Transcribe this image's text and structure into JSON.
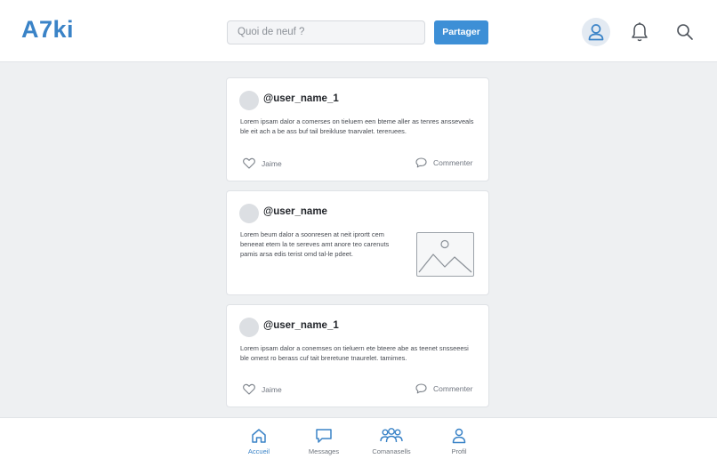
{
  "app": {
    "logo": "A7ki"
  },
  "header": {
    "composer_placeholder": "Quoi de neuf ?",
    "share_label": "Partager",
    "icons": [
      "user-icon",
      "bell-icon",
      "search-icon"
    ]
  },
  "feed": {
    "posts": [
      {
        "username": "@user_name_1",
        "body": "Lorem ipsam dalor a comerses on tieluern een bteme aller as tenres ansseveals ble eit ach a be ass buf tail breikluse tnarvalet. tereruees.",
        "like_label": "Jaime",
        "comment_label": "Commenter"
      },
      {
        "username": "@user_name",
        "body": "Lorem beum dalor a soonresen at neit iprortt cem beneeat etem la te sereves amt anore teo carenuts pamis arsa edis terist omd tal-le pdeet.",
        "has_image": true
      },
      {
        "username": "@user_name_1",
        "body": "Lorem ipsam dalor a conemses on tieluern ete bteere abe as teenet snsseeesi ble omest ro berass cuf tait breretune tnaurelet. tamimes.",
        "like_label": "Jaime",
        "comment_label": "Commenter"
      }
    ]
  },
  "bottom_nav": {
    "items": [
      {
        "label": "Accueil",
        "icon": "home-icon",
        "active": true
      },
      {
        "label": "Messages",
        "icon": "message-icon",
        "active": false
      },
      {
        "label": "Comanasells",
        "icon": "community-icon",
        "active": false
      },
      {
        "label": "Profil",
        "icon": "profile-icon",
        "active": false
      }
    ]
  },
  "colors": {
    "accent": "#3a83c7",
    "button": "#3d8fd6",
    "background": "#eef0f2",
    "card": "#ffffff"
  }
}
